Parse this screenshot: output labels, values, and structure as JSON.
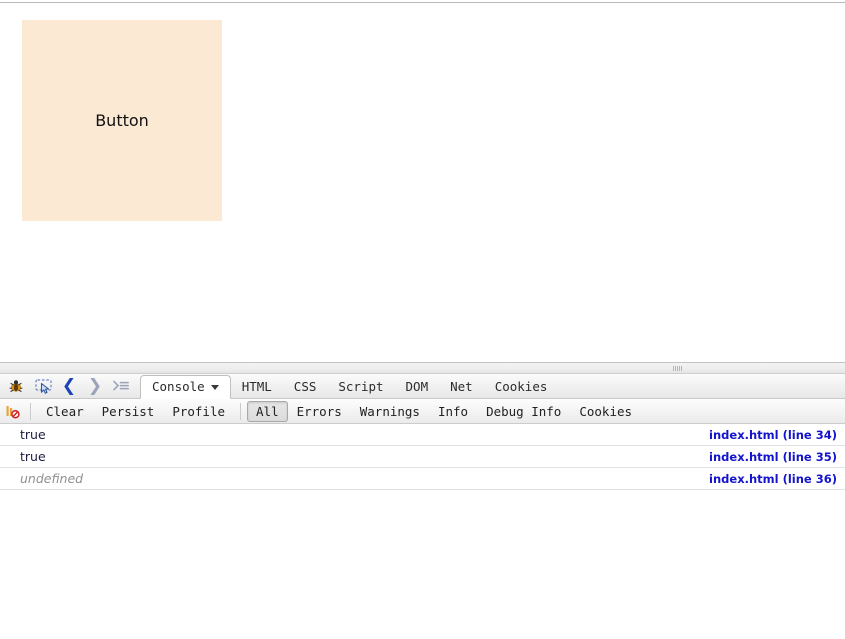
{
  "page": {
    "button": {
      "label": "Button",
      "background": "#fbe9d4",
      "text_color": "#111111"
    }
  },
  "firebug": {
    "toolbar_icons": [
      {
        "name": "firebug-logo-icon",
        "glyph": "🐞"
      },
      {
        "name": "inspect-element-icon",
        "glyph": "↖"
      },
      {
        "name": "back-icon",
        "glyph": "❮"
      },
      {
        "name": "forward-icon",
        "glyph": "❯"
      },
      {
        "name": "command-line-icon",
        "glyph": "≻≡"
      }
    ],
    "tabs": [
      {
        "label": "Console",
        "active": true,
        "has_menu": true
      },
      {
        "label": "HTML",
        "active": false,
        "has_menu": false
      },
      {
        "label": "CSS",
        "active": false,
        "has_menu": false
      },
      {
        "label": "Script",
        "active": false,
        "has_menu": false
      },
      {
        "label": "DOM",
        "active": false,
        "has_menu": false
      },
      {
        "label": "Net",
        "active": false,
        "has_menu": false
      },
      {
        "label": "Cookies",
        "active": false,
        "has_menu": false
      }
    ],
    "actions": [
      {
        "label": "Clear"
      },
      {
        "label": "Persist"
      },
      {
        "label": "Profile"
      }
    ],
    "filters": [
      {
        "label": "All",
        "selected": true
      },
      {
        "label": "Errors",
        "selected": false
      },
      {
        "label": "Warnings",
        "selected": false
      },
      {
        "label": "Info",
        "selected": false
      },
      {
        "label": "Debug Info",
        "selected": false
      },
      {
        "label": "Cookies",
        "selected": false
      }
    ],
    "break_on_error_icon": "break-on-error-icon",
    "log_rows": [
      {
        "value": "true",
        "type": "boolean",
        "source": "index.html (line 34)"
      },
      {
        "value": "true",
        "type": "boolean",
        "source": "index.html (line 35)"
      },
      {
        "value": "undefined",
        "type": "undefined",
        "source": "index.html (line 36)"
      }
    ],
    "link_color": "#1414cc",
    "value_color": "#1c1c40",
    "undefined_color": "#8f8f8f"
  }
}
